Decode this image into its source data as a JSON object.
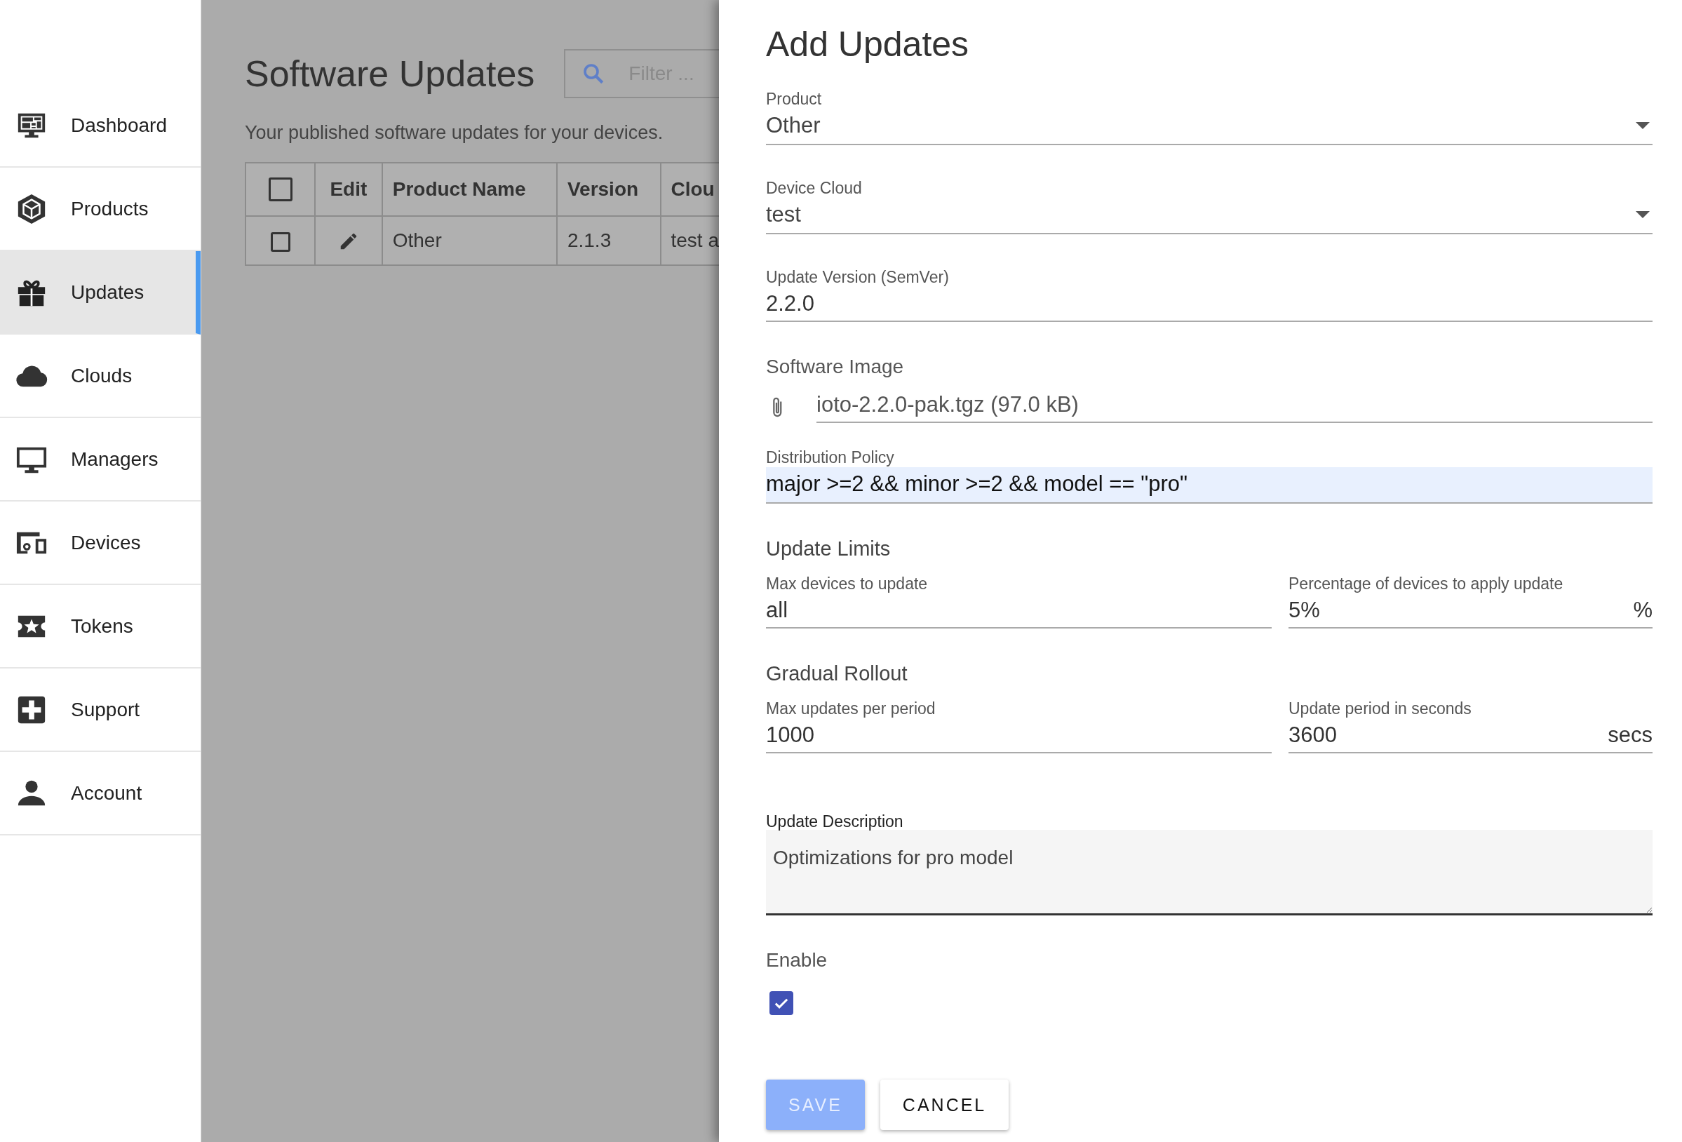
{
  "sidebar": {
    "items": [
      {
        "label": "Dashboard",
        "selected": false
      },
      {
        "label": "Products",
        "selected": false
      },
      {
        "label": "Updates",
        "selected": true
      },
      {
        "label": "Clouds",
        "selected": false
      },
      {
        "label": "Managers",
        "selected": false
      },
      {
        "label": "Devices",
        "selected": false
      },
      {
        "label": "Tokens",
        "selected": false
      },
      {
        "label": "Support",
        "selected": false
      },
      {
        "label": "Account",
        "selected": false
      }
    ]
  },
  "main": {
    "title": "Software Updates",
    "filter": {
      "placeholder": "Filter ..."
    },
    "subtitle": "Your published software updates for your devices.",
    "table": {
      "columns": [
        {
          "kind": "checkbox",
          "checked": false
        },
        {
          "kind": "text",
          "label": "Edit"
        },
        {
          "kind": "text",
          "label": "Product Name"
        },
        {
          "kind": "text",
          "label": "Version"
        },
        {
          "kind": "text",
          "label": "Clou"
        }
      ],
      "rows": [
        {
          "checked": false,
          "cells": [
            "",
            "",
            "Other",
            "2.1.3",
            "test a"
          ]
        }
      ]
    }
  },
  "drawer": {
    "title": "Add Updates",
    "fields": [
      {
        "kind": "select",
        "label": "Product",
        "value": "Other"
      },
      {
        "kind": "select",
        "label": "Device Cloud",
        "value": "test"
      },
      {
        "kind": "text",
        "label": "Update Version (SemVer)",
        "value": "2.2.0"
      },
      {
        "kind": "file",
        "label": "Software Image",
        "value": "ioto-2.2.0-pak.tgz (97.0 kB)"
      },
      {
        "kind": "filled",
        "label": "Distribution Policy",
        "value": "major >=2 && minor >=2 && model == \"pro\""
      }
    ],
    "sections": [
      {
        "heading": "Update Limits",
        "fields": [
          {
            "label": "Max devices to update",
            "value": "all"
          },
          {
            "label": "Percentage of devices to apply update",
            "value": "5%",
            "suffix": "%"
          }
        ]
      },
      {
        "heading": "Gradual Rollout",
        "fields": [
          {
            "label": "Max updates per period",
            "value": "1000"
          },
          {
            "label": "Update period in seconds",
            "value": "3600",
            "suffix": "secs"
          }
        ]
      }
    ],
    "description": {
      "label": "Update Description",
      "value": "Optimizations for pro model"
    },
    "enable": {
      "label": "Enable",
      "checked": true
    },
    "buttons": [
      {
        "label": "SAVE",
        "kind": "primary",
        "disabled": true
      },
      {
        "label": "CANCEL",
        "kind": "secondary",
        "disabled": false
      }
    ]
  }
}
